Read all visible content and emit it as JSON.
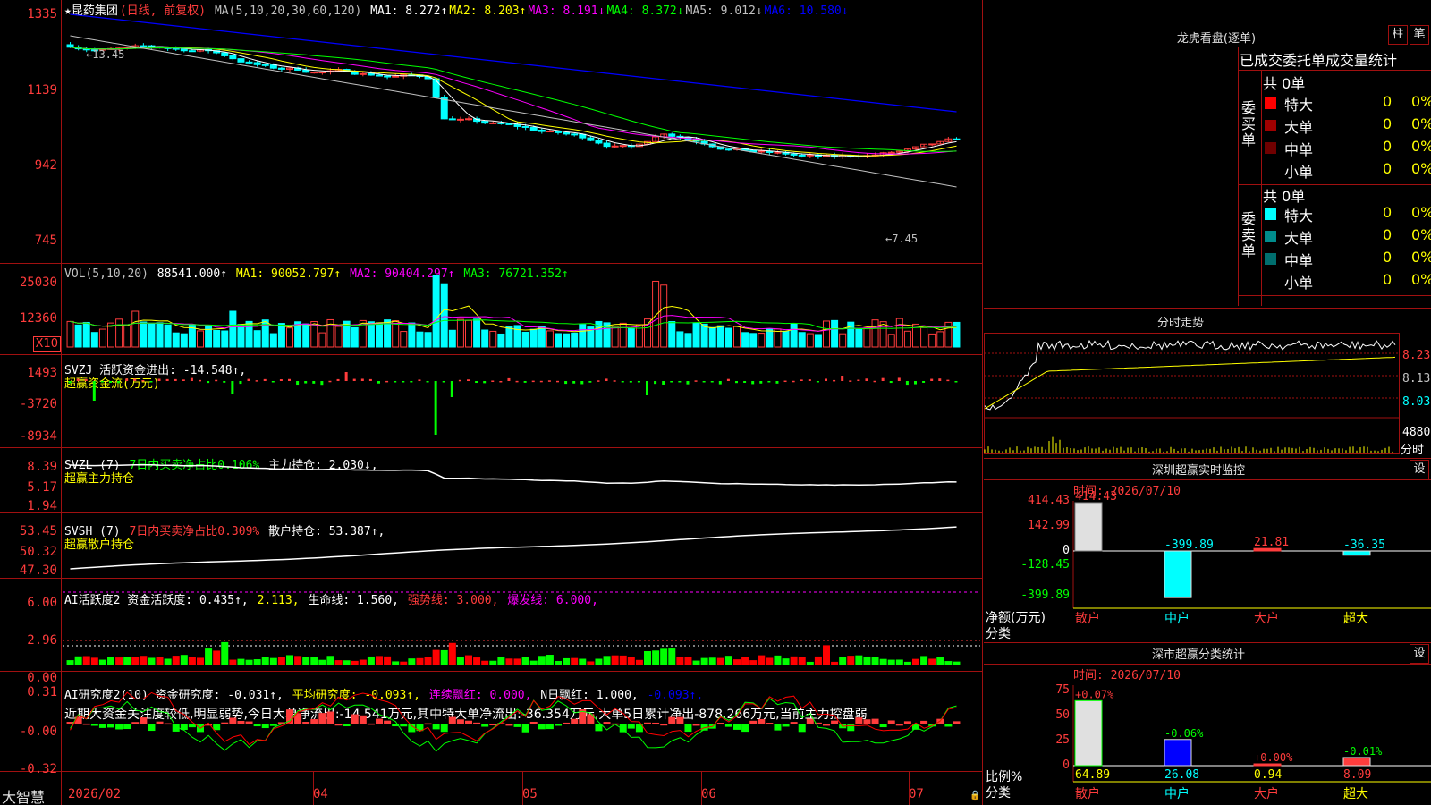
{
  "main_chart": {
    "title": "★昆药集团",
    "period": "(日线, 前复权)",
    "ma_params": "MA(5,10,20,30,60,120)",
    "ma": [
      {
        "label": "MA1:",
        "value": "8.272↑",
        "color": "#ffffff"
      },
      {
        "label": "MA2:",
        "value": "8.203↑",
        "color": "#ffff00"
      },
      {
        "label": "MA3:",
        "value": "8.191↓",
        "color": "#ff00ff"
      },
      {
        "label": "MA4:",
        "value": "8.372↓",
        "color": "#00ff00"
      },
      {
        "label": "MA5:",
        "value": "9.012↓",
        "color": "#c0c0c0"
      },
      {
        "label": "MA6:",
        "value": "10.580↓",
        "color": "#0000ff"
      }
    ],
    "y_ticks": [
      "1335",
      "1139",
      "942",
      "745"
    ],
    "low_marker": "←7.45",
    "high_marker": "←13.45"
  },
  "vol_chart": {
    "legend": "VOL(5,10,20)",
    "value": "88541.000↑",
    "ma1": "MA1: 90052.797↑",
    "ma2": "MA2: 90404.297↑",
    "ma3": "MA3: 76721.352↑",
    "y_ticks": [
      "25030",
      "12360"
    ],
    "unit": "X10"
  },
  "svzj_chart": {
    "legend": "SVZJ  活跃资金进出: -14.548↑,",
    "sub": "超赢资金流(万元)",
    "y_ticks": [
      "1493",
      "-3720",
      "-8934"
    ]
  },
  "svzl_chart": {
    "legend_a": "SVZL (7)",
    "legend_b": "7日内买卖净占比0.106%",
    "legend_c": "主力持仓: 2.030↓,",
    "sub": "超赢主力持仓",
    "y_ticks": [
      "8.39",
      "5.17",
      "1.94"
    ]
  },
  "svsh_chart": {
    "legend_a": "SVSH (7)",
    "legend_b": "7日内买卖净占比0.309%",
    "legend_c": "散户持仓: 53.387↑,",
    "sub": "超赢散户持仓",
    "y_ticks": [
      "53.45",
      "50.32",
      "47.30"
    ]
  },
  "ai_active": {
    "legend_a": "AI活跃度2 资金活跃度: 0.435↑,",
    "legend_b": "2.113,",
    "legend_c": "生命线: 1.560,",
    "legend_d": "强势线: 3.000,",
    "legend_e": "爆发线: 6.000,",
    "y_ticks": [
      "6.00",
      "2.96",
      "0.00"
    ]
  },
  "ai_research": {
    "legend_a": "AI研究度2(10) 资金研究度: -0.031↑,",
    "legend_b": "平均研究度: -0.093↑,",
    "legend_c": "连续飘红: 0.000,",
    "legend_d": "N日飘红: 1.000,",
    "legend_e": "-0.093↑,",
    "comment": "近期大资金关注度较低,明显弱势,今日大单净流出:-14.541万元,其中特大单净流出:-36.354万元,大单5日累计净出-878.266万元,当前主力控盘弱",
    "y_ticks": [
      "0.31",
      "-0.00",
      "-0.32"
    ]
  },
  "x_axis": {
    "brand": "大智慧",
    "labels": [
      "2026/02",
      "04",
      "05",
      "06",
      "07"
    ]
  },
  "dragon": {
    "title": "龙虎看盘(逐单)",
    "btn_bar": "柱",
    "btn_pen": "笔",
    "header": "已成交委托单成交量统计",
    "buy_label": "委买单",
    "sell_label": "委卖单",
    "buy_total": "共 0单",
    "sell_total": "共 0单",
    "buy_rows": [
      {
        "name": "特大",
        "count": "0",
        "pct": "0%",
        "color": "#ff0000"
      },
      {
        "name": "大单",
        "count": "0",
        "pct": "0%",
        "color": "#a00000"
      },
      {
        "name": "中单",
        "count": "0",
        "pct": "0%",
        "color": "#700000"
      },
      {
        "name": "小单",
        "count": "0",
        "pct": "0%",
        "color": "#000000"
      }
    ],
    "sell_rows": [
      {
        "name": "特大",
        "count": "0",
        "pct": "0%",
        "color": "#00ffff"
      },
      {
        "name": "大单",
        "count": "0",
        "pct": "0%",
        "color": "#008c8c"
      },
      {
        "name": "中单",
        "count": "0",
        "pct": "0%",
        "color": "#006e6e"
      },
      {
        "name": "小单",
        "count": "0",
        "pct": "0%",
        "color": "#000000"
      }
    ]
  },
  "intraday": {
    "title": "分时走势",
    "y_ticks": [
      "8.23",
      "8.13",
      "8.03"
    ],
    "vol_tick": "4880",
    "vol_unit": "分时"
  },
  "shenzhen_monitor": {
    "title": "深圳超赢实时监控",
    "btn": "设",
    "time": "时间: 2026/07/10",
    "y_ticks": [
      "414.43",
      "142.99",
      "0",
      "-128.45",
      "-399.89"
    ],
    "ylabel_a": "净额(万元)",
    "ylabel_b": "分类",
    "categories": [
      "散户",
      "中户",
      "大户",
      "超大"
    ],
    "values": [
      414.43,
      -399.89,
      21.81,
      -36.35
    ],
    "value_labels": [
      "414.43",
      "-399.89",
      "21.81",
      "-36.35"
    ]
  },
  "shenzhen_stats": {
    "title": "深市超赢分类统计",
    "btn": "设",
    "time": "时间: 2026/07/10",
    "y_ticks": [
      "75",
      "50",
      "25",
      "0"
    ],
    "ylabel_a": "比例%",
    "ylabel_b": "分类",
    "categories": [
      "散户",
      "中户",
      "大户",
      "超大"
    ],
    "values": [
      64.89,
      26.08,
      0.94,
      8.09
    ],
    "value_labels": [
      "64.89",
      "26.08",
      "0.94",
      "8.09"
    ],
    "changes": [
      "+0.07%",
      "-0.06%",
      "+0.00%",
      "-0.01%"
    ]
  }
}
